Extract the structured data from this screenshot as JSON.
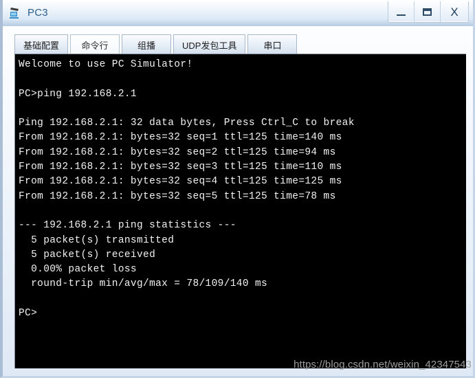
{
  "window": {
    "title": "PC3",
    "icon": "pc-simulator-icon",
    "controls": {
      "minimize_label": "_",
      "maximize_label": "□",
      "close_label": "X"
    }
  },
  "tabs": [
    {
      "label": "基础配置",
      "active": false
    },
    {
      "label": "命令行",
      "active": true
    },
    {
      "label": "组播",
      "active": false
    },
    {
      "label": "UDP发包工具",
      "active": false
    },
    {
      "label": "串口",
      "active": false
    }
  ],
  "terminal": {
    "background": "#000000",
    "foreground": "#f2f2f2",
    "lines": [
      "Welcome to use PC Simulator!",
      "",
      "PC>ping 192.168.2.1",
      "",
      "Ping 192.168.2.1: 32 data bytes, Press Ctrl_C to break",
      "From 192.168.2.1: bytes=32 seq=1 ttl=125 time=140 ms",
      "From 192.168.2.1: bytes=32 seq=2 ttl=125 time=94 ms",
      "From 192.168.2.1: bytes=32 seq=3 ttl=125 time=110 ms",
      "From 192.168.2.1: bytes=32 seq=4 ttl=125 time=125 ms",
      "From 192.168.2.1: bytes=32 seq=5 ttl=125 time=78 ms",
      "",
      "--- 192.168.2.1 ping statistics ---",
      "  5 packet(s) transmitted",
      "  5 packet(s) received",
      "  0.00% packet loss",
      "  round-trip min/avg/max = 78/109/140 ms",
      "",
      "PC>"
    ]
  },
  "watermark": {
    "text": "https://blog.csdn.net/weixin_42347543"
  }
}
